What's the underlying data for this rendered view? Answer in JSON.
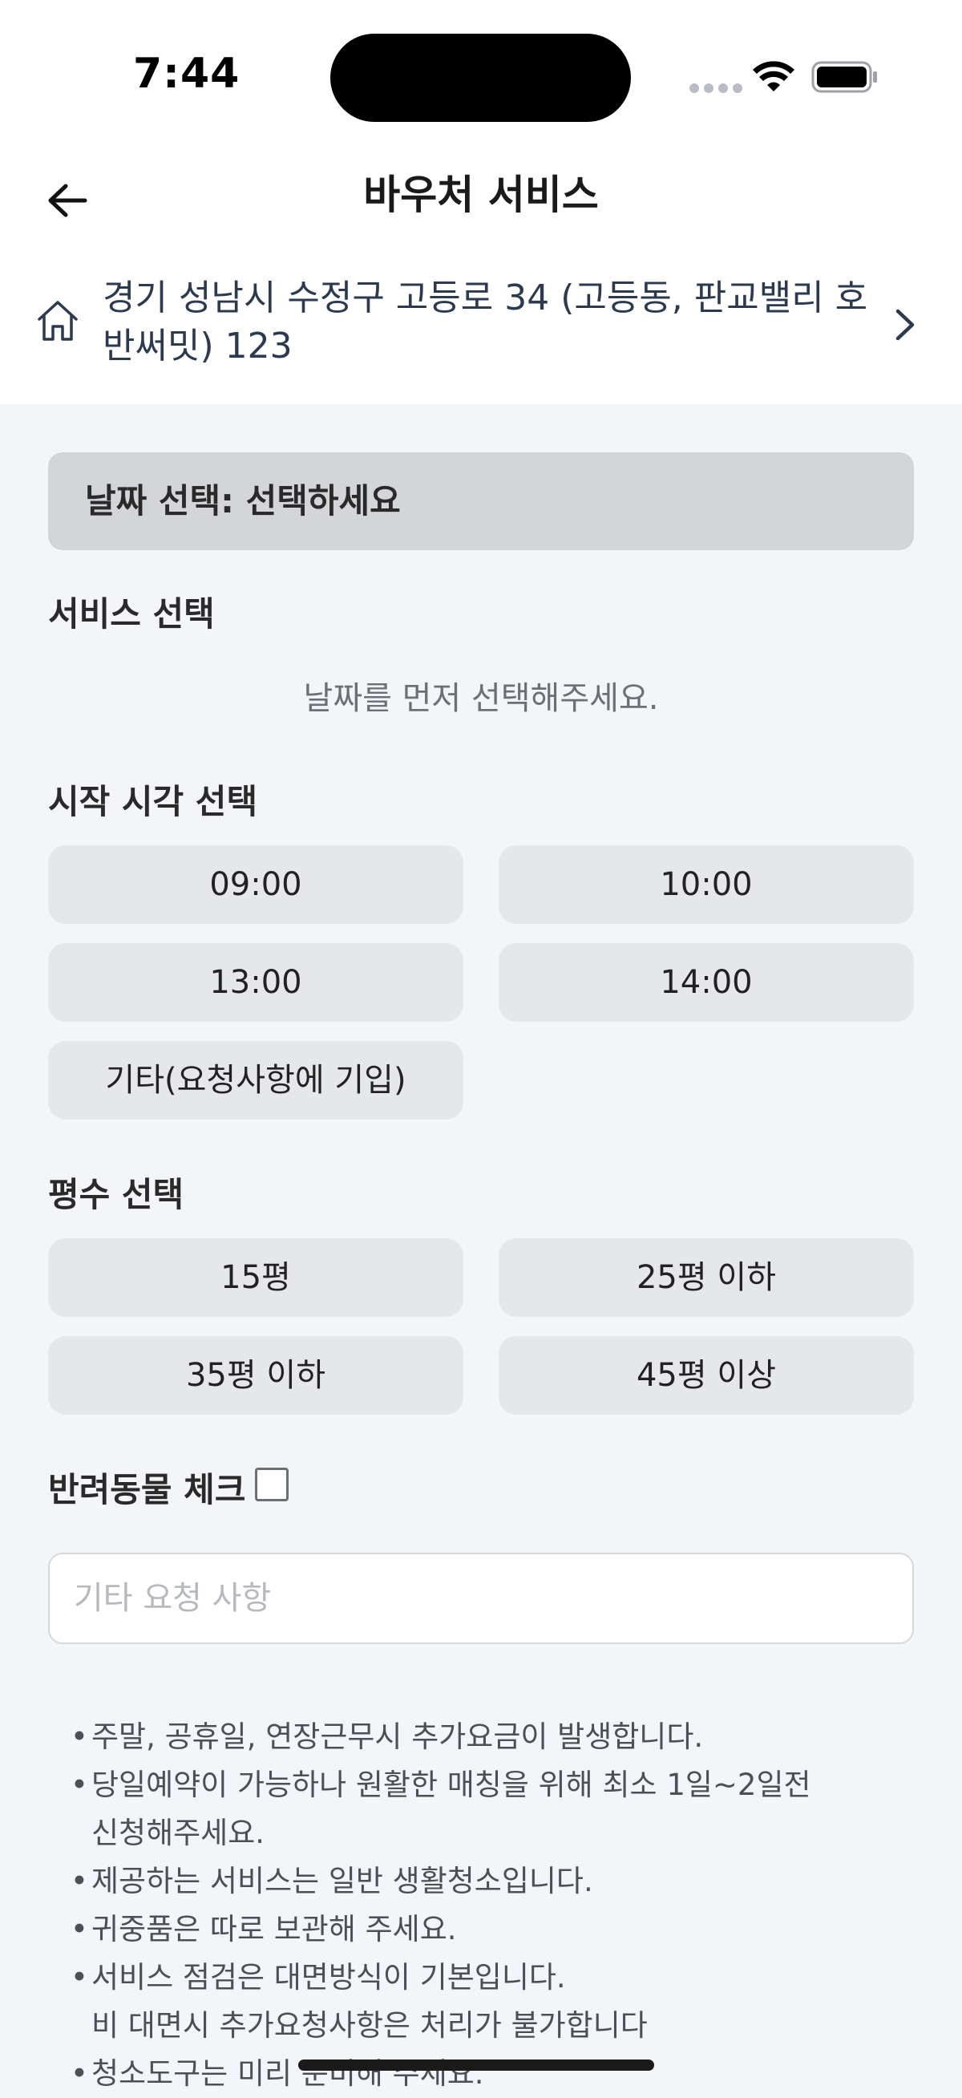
{
  "status_bar": {
    "time": "7:44"
  },
  "header": {
    "title": "바우처 서비스",
    "back_icon": "arrow-left-icon"
  },
  "address": {
    "line1": "경기 성남시 수정구 고등로 34 (고등동, 판교밸리 호",
    "line2": "반써밋) 123",
    "icon": "home-icon"
  },
  "date_select": {
    "label": "날짜 선택: 선택하세요"
  },
  "service_section": {
    "title": "서비스 선택",
    "empty_message": "날짜를 먼저 선택해주세요."
  },
  "start_time_section": {
    "title": "시작 시각 선택",
    "options": [
      "09:00",
      "10:00",
      "13:00",
      "14:00",
      "기타(요청사항에 기입)"
    ]
  },
  "area_section": {
    "title": "평수 선택",
    "options": [
      "15평",
      "25평 이하",
      "35평 이하",
      "45평 이상"
    ]
  },
  "pet_check": {
    "label": "반려동물 체크",
    "checked": false
  },
  "request_input": {
    "placeholder": "기타 요청 사항",
    "value": ""
  },
  "notes": [
    "주말, 공휴일, 연장근무시 추가요금이 발생합니다.",
    "당일예약이 가능하나 원활한 매칭을 위해 최소 1일~2일전",
    "신청해주세요.",
    "제공하는 서비스는 일반 생활청소입니다.",
    "귀중품은 따로 보관해 주세요.",
    "서비스 점검은 대면방식이 기본입니다.",
    "비 대면시 추가요청사항은 처리가 불가합니다",
    "청소도구는 미리 준비해 주세요."
  ],
  "colors": {
    "background": "#f4f5f9",
    "chip": "#e6e7ea",
    "date_select": "#d3d5d9",
    "text_primary": "#2a2a2a",
    "text_secondary": "#4b5058"
  }
}
